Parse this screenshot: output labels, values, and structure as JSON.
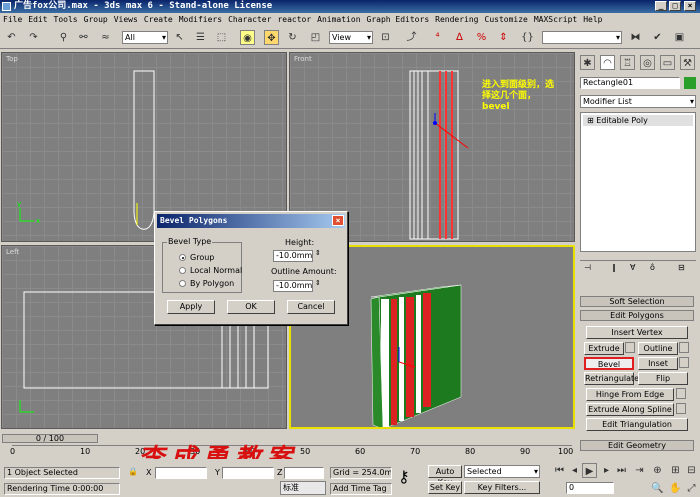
{
  "window": {
    "title": "广告fox公司.max - 3ds max 6 - Stand-alone License"
  },
  "menu": [
    "File",
    "Edit",
    "Tools",
    "Group",
    "Views",
    "Create",
    "Modifiers",
    "Character",
    "reactor",
    "Animation",
    "Graph Editors",
    "Rendering",
    "Customize",
    "MAXScript",
    "Help"
  ],
  "toolbar": {
    "selection_filter": "All",
    "coord_system": "View"
  },
  "viewports": {
    "top": "Top",
    "front": "Front",
    "left": "Left"
  },
  "annotation_text": "进入到面级别，选择这几个面，bevel",
  "watermark_text": "李成勇教案",
  "command_panel": {
    "object_name": "Rectangle01",
    "modifier_list": "Modifier List",
    "stack_item": "Editable Poly",
    "rollouts": {
      "soft_selection": "Soft Selection",
      "edit_polygons": "Edit Polygons",
      "edit_geometry": "Edit Geometry"
    },
    "buttons": {
      "insert_vertex": "Insert Vertex",
      "extrude": "Extrude",
      "outline": "Outline",
      "bevel": "Bevel",
      "inset": "Inset",
      "retriangulate": "Retriangulate",
      "flip": "Flip",
      "hinge_from_edge": "Hinge From Edge",
      "extrude_along_spline": "Extrude Along Spline",
      "edit_triangulation": "Edit Triangulation"
    }
  },
  "dialog": {
    "title": "Bevel Polygons",
    "bevel_type_label": "Bevel Type",
    "options": [
      "Group",
      "Local Normal",
      "By Polygon"
    ],
    "selected_option": "Group",
    "height_label": "Height:",
    "height_value": "-10.0mm",
    "outline_label": "Outline Amount:",
    "outline_value": "-10.0mm",
    "apply": "Apply",
    "ok": "OK",
    "cancel": "Cancel"
  },
  "trackbar": {
    "frame_display": "0 / 100",
    "ticks": [
      "0",
      "10",
      "20",
      "30",
      "40",
      "50",
      "60",
      "70",
      "80",
      "90",
      "100"
    ]
  },
  "status": {
    "selection_info": "1 Object Selected",
    "render_info": "Rendering Time 0:00:00",
    "x_label": "X",
    "y_label": "Y",
    "z_label": "Z",
    "grid": "Grid = 254.0mm",
    "add_time_tag": "Add Time Tag",
    "auto_key": "Auto Key",
    "set_key": "Set Key",
    "key_mode": "Selected",
    "key_filters": "Key Filters...",
    "frame_value": "0",
    "ime_label": "标准"
  }
}
